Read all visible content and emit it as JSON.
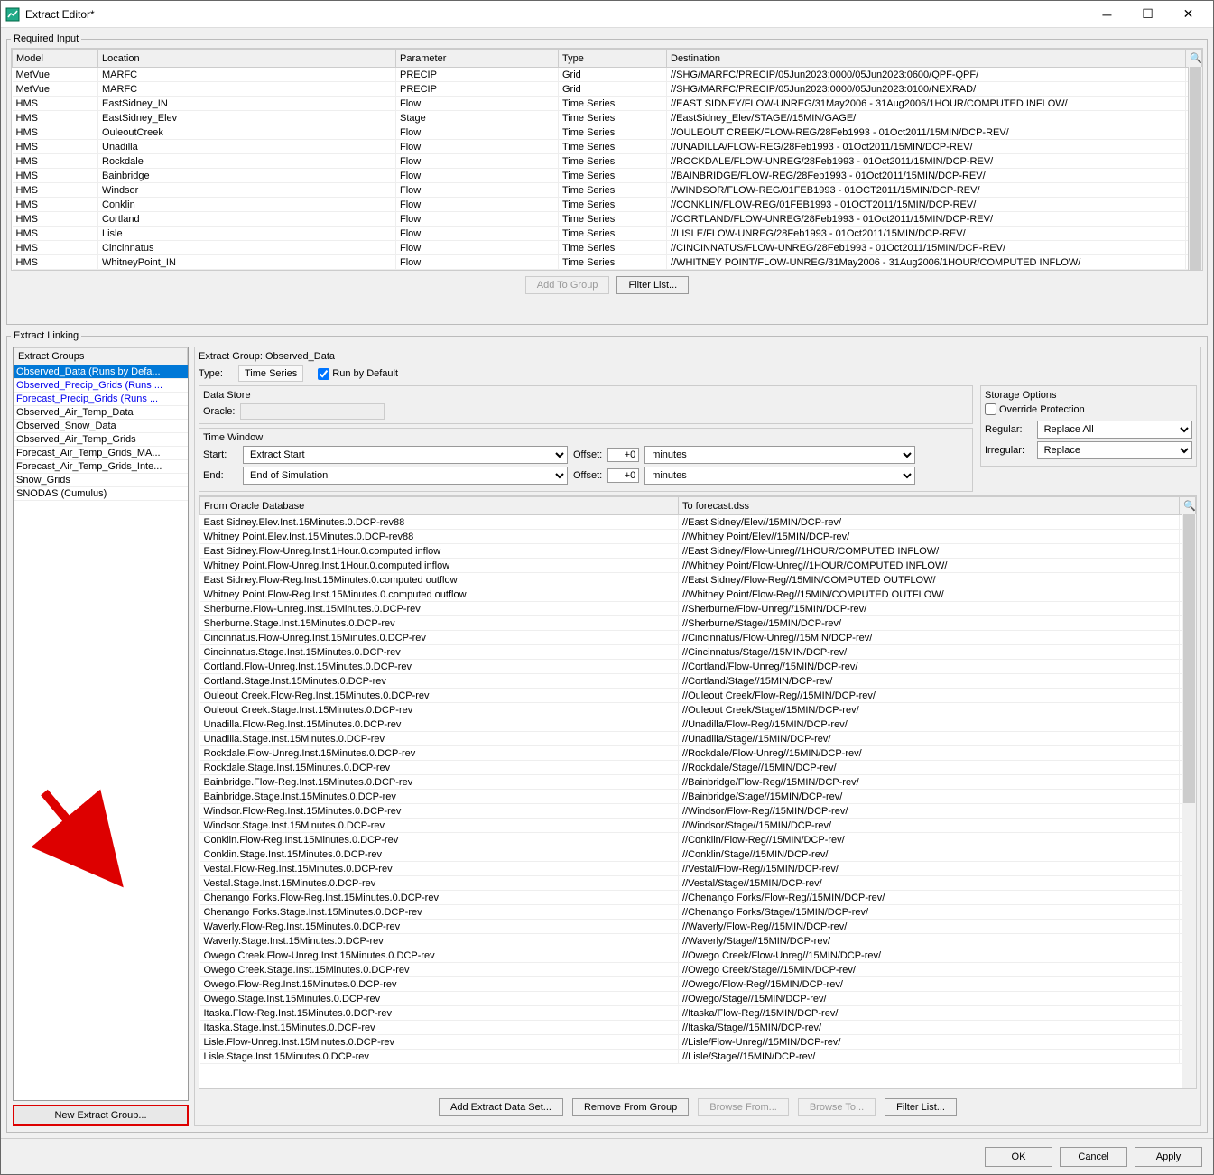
{
  "window": {
    "title": "Extract Editor*"
  },
  "required_input": {
    "legend": "Required Input",
    "headers": [
      "Model",
      "Location",
      "Parameter",
      "Type",
      "Destination"
    ],
    "rows": [
      [
        "MetVue",
        "MARFC",
        "PRECIP",
        "Grid",
        "//SHG/MARFC/PRECIP/05Jun2023:0000/05Jun2023:0600/QPF-QPF/"
      ],
      [
        "MetVue",
        "MARFC",
        "PRECIP",
        "Grid",
        "//SHG/MARFC/PRECIP/05Jun2023:0000/05Jun2023:0100/NEXRAD/"
      ],
      [
        "HMS",
        "EastSidney_IN",
        "Flow",
        "Time Series",
        "//EAST SIDNEY/FLOW-UNREG/31May2006 - 31Aug2006/1HOUR/COMPUTED INFLOW/"
      ],
      [
        "HMS",
        "EastSidney_Elev",
        "Stage",
        "Time Series",
        "//EastSidney_Elev/STAGE//15MIN/GAGE/"
      ],
      [
        "HMS",
        "OuleoutCreek",
        "Flow",
        "Time Series",
        "//OULEOUT CREEK/FLOW-REG/28Feb1993 - 01Oct2011/15MIN/DCP-REV/"
      ],
      [
        "HMS",
        "Unadilla",
        "Flow",
        "Time Series",
        "//UNADILLA/FLOW-REG/28Feb1993 - 01Oct2011/15MIN/DCP-REV/"
      ],
      [
        "HMS",
        "Rockdale",
        "Flow",
        "Time Series",
        "//ROCKDALE/FLOW-UNREG/28Feb1993 - 01Oct2011/15MIN/DCP-REV/"
      ],
      [
        "HMS",
        "Bainbridge",
        "Flow",
        "Time Series",
        "//BAINBRIDGE/FLOW-REG/28Feb1993 - 01Oct2011/15MIN/DCP-REV/"
      ],
      [
        "HMS",
        "Windsor",
        "Flow",
        "Time Series",
        "//WINDSOR/FLOW-REG/01FEB1993 - 01OCT2011/15MIN/DCP-REV/"
      ],
      [
        "HMS",
        "Conklin",
        "Flow",
        "Time Series",
        "//CONKLIN/FLOW-REG/01FEB1993 - 01OCT2011/15MIN/DCP-REV/"
      ],
      [
        "HMS",
        "Cortland",
        "Flow",
        "Time Series",
        "//CORTLAND/FLOW-UNREG/28Feb1993 - 01Oct2011/15MIN/DCP-REV/"
      ],
      [
        "HMS",
        "Lisle",
        "Flow",
        "Time Series",
        "//LISLE/FLOW-UNREG/28Feb1993 - 01Oct2011/15MIN/DCP-REV/"
      ],
      [
        "HMS",
        "Cincinnatus",
        "Flow",
        "Time Series",
        "//CINCINNATUS/FLOW-UNREG/28Feb1993 - 01Oct2011/15MIN/DCP-REV/"
      ],
      [
        "HMS",
        "WhitneyPoint_IN",
        "Flow",
        "Time Series",
        "//WHITNEY POINT/FLOW-UNREG/31May2006 - 31Aug2006/1HOUR/COMPUTED INFLOW/"
      ]
    ],
    "buttons": {
      "add": "Add To Group",
      "filter": "Filter List..."
    }
  },
  "extract_linking": {
    "legend": "Extract Linking",
    "groups_header": "Extract Groups",
    "groups": [
      {
        "label": "Observed_Data (Runs by Defa...",
        "selected": true,
        "blue": false
      },
      {
        "label": "Observed_Precip_Grids (Runs ...",
        "selected": false,
        "blue": true
      },
      {
        "label": "Forecast_Precip_Grids (Runs ...",
        "selected": false,
        "blue": true
      },
      {
        "label": "Observed_Air_Temp_Data",
        "selected": false,
        "blue": false
      },
      {
        "label": "Observed_Snow_Data",
        "selected": false,
        "blue": false
      },
      {
        "label": "Observed_Air_Temp_Grids",
        "selected": false,
        "blue": false
      },
      {
        "label": "Forecast_Air_Temp_Grids_MA...",
        "selected": false,
        "blue": false
      },
      {
        "label": "Forecast_Air_Temp_Grids_Inte...",
        "selected": false,
        "blue": false
      },
      {
        "label": "Snow_Grids",
        "selected": false,
        "blue": false
      },
      {
        "label": "SNODAS (Cumulus)",
        "selected": false,
        "blue": false
      }
    ],
    "new_group_btn": "New Extract Group...",
    "group_title": "Extract Group: Observed_Data",
    "type_label": "Type:",
    "type_value": "Time Series",
    "run_by_default": "Run by Default",
    "data_store": {
      "title": "Data Store",
      "oracle_label": "Oracle:"
    },
    "time_window": {
      "title": "Time Window",
      "start_label": "Start:",
      "start_value": "Extract Start",
      "end_label": "End:",
      "end_value": "End of Simulation",
      "offset_label": "Offset:",
      "offset_value": "+0",
      "unit": "minutes"
    },
    "storage": {
      "title": "Storage Options",
      "override": "Override Protection",
      "regular_label": "Regular:",
      "regular_value": "Replace All",
      "irregular_label": "Irregular:",
      "irregular_value": "Replace"
    },
    "db_headers": [
      "From Oracle Database",
      "To forecast.dss"
    ],
    "db_rows": [
      [
        "East Sidney.Elev.Inst.15Minutes.0.DCP-rev88",
        "//East Sidney/Elev//15MIN/DCP-rev/"
      ],
      [
        "Whitney Point.Elev.Inst.15Minutes.0.DCP-rev88",
        "//Whitney Point/Elev//15MIN/DCP-rev/"
      ],
      [
        "East Sidney.Flow-Unreg.Inst.1Hour.0.computed inflow",
        "//East Sidney/Flow-Unreg//1HOUR/COMPUTED INFLOW/"
      ],
      [
        "Whitney Point.Flow-Unreg.Inst.1Hour.0.computed inflow",
        "//Whitney Point/Flow-Unreg//1HOUR/COMPUTED INFLOW/"
      ],
      [
        "East Sidney.Flow-Reg.Inst.15Minutes.0.computed outflow",
        "//East Sidney/Flow-Reg//15MIN/COMPUTED OUTFLOW/"
      ],
      [
        "Whitney Point.Flow-Reg.Inst.15Minutes.0.computed outflow",
        "//Whitney Point/Flow-Reg//15MIN/COMPUTED OUTFLOW/"
      ],
      [
        "Sherburne.Flow-Unreg.Inst.15Minutes.0.DCP-rev",
        "//Sherburne/Flow-Unreg//15MIN/DCP-rev/"
      ],
      [
        "Sherburne.Stage.Inst.15Minutes.0.DCP-rev",
        "//Sherburne/Stage//15MIN/DCP-rev/"
      ],
      [
        "Cincinnatus.Flow-Unreg.Inst.15Minutes.0.DCP-rev",
        "//Cincinnatus/Flow-Unreg//15MIN/DCP-rev/"
      ],
      [
        "Cincinnatus.Stage.Inst.15Minutes.0.DCP-rev",
        "//Cincinnatus/Stage//15MIN/DCP-rev/"
      ],
      [
        "Cortland.Flow-Unreg.Inst.15Minutes.0.DCP-rev",
        "//Cortland/Flow-Unreg//15MIN/DCP-rev/"
      ],
      [
        "Cortland.Stage.Inst.15Minutes.0.DCP-rev",
        "//Cortland/Stage//15MIN/DCP-rev/"
      ],
      [
        "Ouleout Creek.Flow-Reg.Inst.15Minutes.0.DCP-rev",
        "//Ouleout Creek/Flow-Reg//15MIN/DCP-rev/"
      ],
      [
        "Ouleout Creek.Stage.Inst.15Minutes.0.DCP-rev",
        "//Ouleout Creek/Stage//15MIN/DCP-rev/"
      ],
      [
        "Unadilla.Flow-Reg.Inst.15Minutes.0.DCP-rev",
        "//Unadilla/Flow-Reg//15MIN/DCP-rev/"
      ],
      [
        "Unadilla.Stage.Inst.15Minutes.0.DCP-rev",
        "//Unadilla/Stage//15MIN/DCP-rev/"
      ],
      [
        "Rockdale.Flow-Unreg.Inst.15Minutes.0.DCP-rev",
        "//Rockdale/Flow-Unreg//15MIN/DCP-rev/"
      ],
      [
        "Rockdale.Stage.Inst.15Minutes.0.DCP-rev",
        "//Rockdale/Stage//15MIN/DCP-rev/"
      ],
      [
        "Bainbridge.Flow-Reg.Inst.15Minutes.0.DCP-rev",
        "//Bainbridge/Flow-Reg//15MIN/DCP-rev/"
      ],
      [
        "Bainbridge.Stage.Inst.15Minutes.0.DCP-rev",
        "//Bainbridge/Stage//15MIN/DCP-rev/"
      ],
      [
        "Windsor.Flow-Reg.Inst.15Minutes.0.DCP-rev",
        "//Windsor/Flow-Reg//15MIN/DCP-rev/"
      ],
      [
        "Windsor.Stage.Inst.15Minutes.0.DCP-rev",
        "//Windsor/Stage//15MIN/DCP-rev/"
      ],
      [
        "Conklin.Flow-Reg.Inst.15Minutes.0.DCP-rev",
        "//Conklin/Flow-Reg//15MIN/DCP-rev/"
      ],
      [
        "Conklin.Stage.Inst.15Minutes.0.DCP-rev",
        "//Conklin/Stage//15MIN/DCP-rev/"
      ],
      [
        "Vestal.Flow-Reg.Inst.15Minutes.0.DCP-rev",
        "//Vestal/Flow-Reg//15MIN/DCP-rev/"
      ],
      [
        "Vestal.Stage.Inst.15Minutes.0.DCP-rev",
        "//Vestal/Stage//15MIN/DCP-rev/"
      ],
      [
        "Chenango Forks.Flow-Reg.Inst.15Minutes.0.DCP-rev",
        "//Chenango Forks/Flow-Reg//15MIN/DCP-rev/"
      ],
      [
        "Chenango Forks.Stage.Inst.15Minutes.0.DCP-rev",
        "//Chenango Forks/Stage//15MIN/DCP-rev/"
      ],
      [
        "Waverly.Flow-Reg.Inst.15Minutes.0.DCP-rev",
        "//Waverly/Flow-Reg//15MIN/DCP-rev/"
      ],
      [
        "Waverly.Stage.Inst.15Minutes.0.DCP-rev",
        "//Waverly/Stage//15MIN/DCP-rev/"
      ],
      [
        "Owego Creek.Flow-Unreg.Inst.15Minutes.0.DCP-rev",
        "//Owego Creek/Flow-Unreg//15MIN/DCP-rev/"
      ],
      [
        "Owego Creek.Stage.Inst.15Minutes.0.DCP-rev",
        "//Owego Creek/Stage//15MIN/DCP-rev/"
      ],
      [
        "Owego.Flow-Reg.Inst.15Minutes.0.DCP-rev",
        "//Owego/Flow-Reg//15MIN/DCP-rev/"
      ],
      [
        "Owego.Stage.Inst.15Minutes.0.DCP-rev",
        "//Owego/Stage//15MIN/DCP-rev/"
      ],
      [
        "Itaska.Flow-Reg.Inst.15Minutes.0.DCP-rev",
        "//Itaska/Flow-Reg//15MIN/DCP-rev/"
      ],
      [
        "Itaska.Stage.Inst.15Minutes.0.DCP-rev",
        "//Itaska/Stage//15MIN/DCP-rev/"
      ],
      [
        "Lisle.Flow-Unreg.Inst.15Minutes.0.DCP-rev",
        "//Lisle/Flow-Unreg//15MIN/DCP-rev/"
      ],
      [
        "Lisle.Stage.Inst.15Minutes.0.DCP-rev",
        "//Lisle/Stage//15MIN/DCP-rev/"
      ]
    ],
    "bottom_buttons": {
      "add": "Add Extract Data Set...",
      "remove": "Remove From Group",
      "browse_from": "Browse From...",
      "browse_to": "Browse To...",
      "filter": "Filter List..."
    }
  },
  "footer": {
    "ok": "OK",
    "cancel": "Cancel",
    "apply": "Apply"
  }
}
